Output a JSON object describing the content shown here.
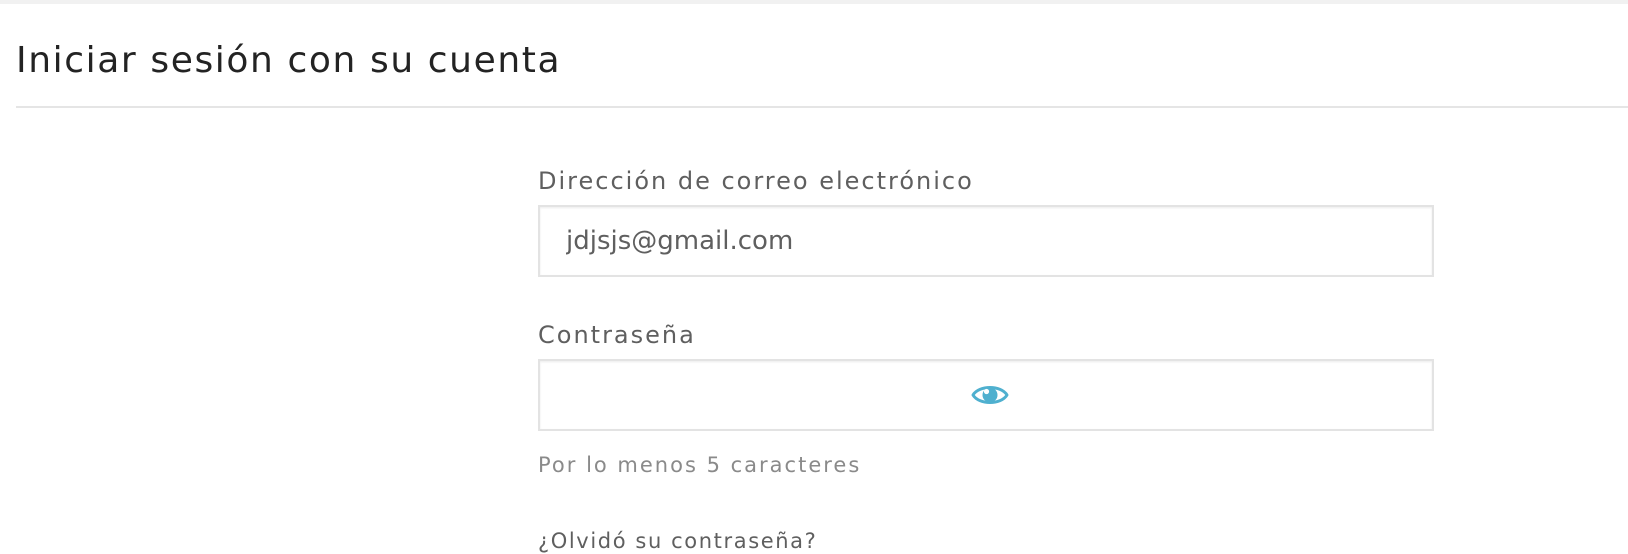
{
  "page": {
    "title": "Iniciar sesión con su cuenta"
  },
  "form": {
    "email": {
      "label": "Dirección de correo electrónico",
      "value": "jdjsjs@gmail.com"
    },
    "password": {
      "label": "Contraseña",
      "value": "",
      "toggle_icon": "eye-icon",
      "hint": "Por lo menos 5 caracteres"
    },
    "forgot_password_link": "¿Olvidó su contraseña?"
  },
  "colors": {
    "accent": "#4fb0cf",
    "title_text": "#232323",
    "label_text": "#5f5f5f",
    "hint_text": "#8a8a8a",
    "border": "#e3e3e3"
  }
}
